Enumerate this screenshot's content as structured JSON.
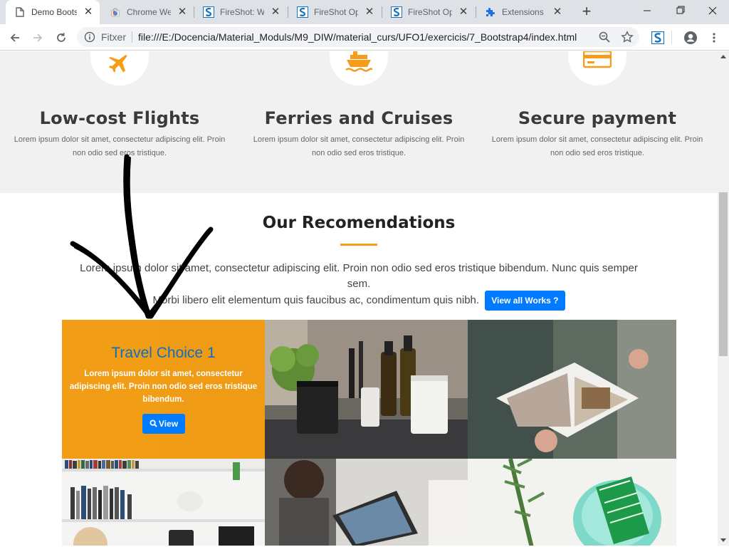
{
  "browser": {
    "tabs": [
      {
        "title": "Demo Boots",
        "icon": "document-icon",
        "active": true
      },
      {
        "title": "Chrome Web",
        "icon": "chrome-webstore-icon",
        "active": false
      },
      {
        "title": "FireShot: We",
        "icon": "fireshot-icon",
        "active": false
      },
      {
        "title": "FireShot Opt",
        "icon": "fireshot-icon",
        "active": false
      },
      {
        "title": "FireShot Opt",
        "icon": "fireshot-icon",
        "active": false
      },
      {
        "title": "Extensions",
        "icon": "puzzle-icon",
        "active": false
      }
    ],
    "omnibox": {
      "security_label": "Fitxer",
      "url": "file:///E:/Docencia/Material_Moduls/M9_DIW/material_curs/UFO1/exercicis/7_Bootstrap4/index.html"
    }
  },
  "features": [
    {
      "title": "Low-cost Flights",
      "text": "Lorem ipsum dolor sit amet, consectetur adipiscing elit. Proin non odio sed eros tristique.",
      "icon": "airplane-icon"
    },
    {
      "title": "Ferries and Cruises",
      "text": "Lorem ipsum dolor sit amet, consectetur adipiscing elit. Proin non odio sed eros tristique.",
      "icon": "ship-icon"
    },
    {
      "title": "Secure payment",
      "text": "Lorem ipsum dolor sit amet, consectetur adipiscing elit. Proin non odio sed eros tristique.",
      "icon": "credit-card-icon"
    }
  ],
  "recommendations": {
    "title": "Our Recomendations",
    "text1": "Lorem ipsum dolor sit amet, consectetur adipiscing elit. Proin non odio sed eros tristique bibendum. Nunc quis semper sem.",
    "text2": "Morbi libero elit elementum quis faucibus ac, condimentum quis nibh.",
    "button_label": "View all Works ?",
    "featured_card": {
      "title": "Travel Choice 1",
      "text": "Lorem ipsum dolor sit amet, consectetur adipiscing elit. Proin non odio sed eros tristique bibendum.",
      "button_label": "View"
    }
  },
  "colors": {
    "accent_orange": "#f59c1a",
    "button_blue": "#007bff",
    "card_title_blue": "#0d6ec0"
  }
}
